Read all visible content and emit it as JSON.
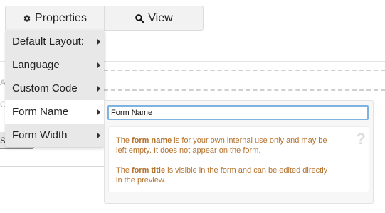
{
  "toolbar": {
    "properties_label": "Properties",
    "properties_icon": "gear-icon",
    "view_label": "View",
    "view_icon": "search-icon"
  },
  "menu": {
    "items": [
      {
        "label": "Default Layout:",
        "active": false
      },
      {
        "label": "Language",
        "active": false
      },
      {
        "label": "Custom Code",
        "active": false
      },
      {
        "label": "Form Name",
        "active": true
      },
      {
        "label": "Form Width",
        "active": false
      }
    ]
  },
  "form_name_panel": {
    "input_value": "Form Name",
    "help_icon": "?",
    "help": {
      "p1_a": "The ",
      "p1_bold": "form name",
      "p1_b": " is for your own internal use only and may be left empty. It does not appear on the form.",
      "p2_a": "The ",
      "p2_bold": "form title",
      "p2_b": " is visible in the form and can be edited directly in the preview."
    }
  },
  "background": {
    "frag_1": "Ac",
    "frag_2": "Cl",
    "frag_3": "Su"
  },
  "colors": {
    "help_text": "#b5722d",
    "input_focus_border": "#7fb2de",
    "menu_bg": "#e8e8e8"
  }
}
